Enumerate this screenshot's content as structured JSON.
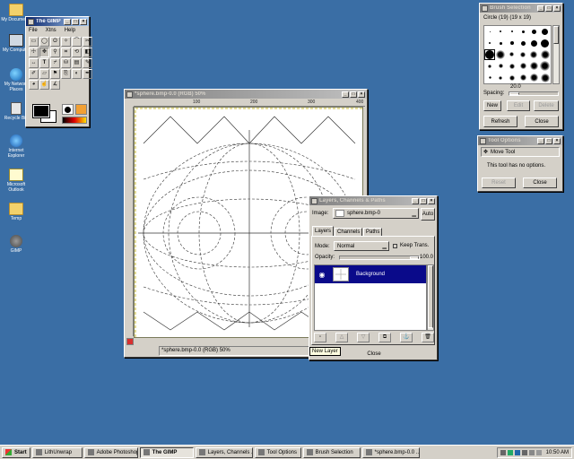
{
  "desktop": {
    "icons": [
      {
        "label": "My Documents",
        "icon": "folder-icon"
      },
      {
        "label": "My Computer",
        "icon": "computer-icon"
      },
      {
        "label": "My Network Places",
        "icon": "network-icon"
      },
      {
        "label": "Recycle Bin",
        "icon": "recycle-bin-icon"
      },
      {
        "label": "Internet Explorer",
        "icon": "internet-explorer-icon"
      },
      {
        "label": "Microsoft Outlook",
        "icon": "outlook-icon"
      },
      {
        "label": "Temp",
        "icon": "folder-icon"
      },
      {
        "label": "GIMP",
        "icon": "gimp-icon"
      }
    ]
  },
  "toolbox": {
    "title": "The GIMP",
    "menu": [
      "File",
      "Xtns",
      "Help"
    ]
  },
  "brush": {
    "title": "Brush Selection",
    "brush_name": "Circle (19)  (19 x 19)",
    "spacing_label": "Spacing:",
    "spacing_value": "20.0",
    "buttons": {
      "new": "New",
      "edit": "Edit",
      "delete": "Delete",
      "refresh": "Refresh",
      "close": "Close"
    }
  },
  "tool_options": {
    "title": "Tool Options",
    "tool_name": "Move Tool",
    "message": "This tool has no options.",
    "reset": "Reset",
    "close": "Close"
  },
  "image_window": {
    "title": "*sphere.bmp-0.0 (RGB) 50%",
    "status": "*sphere.bmp-0.0 (RGB) 50%",
    "ruler_marks": [
      "100",
      "200",
      "300",
      "400"
    ]
  },
  "layers": {
    "title": "Layers, Channels & Paths",
    "image_label": "Image:",
    "image_value": "sphere.bmp-0",
    "auto_label": "Auto",
    "tabs": [
      "Layers",
      "Channels",
      "Paths"
    ],
    "mode_label": "Mode:",
    "mode_value": "Normal",
    "keep_trans_label": "Keep Trans.",
    "opacity_label": "Opacity:",
    "opacity_value": "100.0",
    "layer_name": "Background",
    "tooltip": "New Layer",
    "close": "Close"
  },
  "taskbar": {
    "start": "Start",
    "items": [
      "LithUnwrap",
      "Adobe Photoshop",
      "The GIMP",
      "Layers, Channels ...",
      "Tool Options",
      "Brush Selection",
      "*sphere.bmp-0.0 ..."
    ],
    "active_index": 2,
    "clock": "10:50 AM"
  },
  "colors": {
    "desktop": "#3a6ea5",
    "title_active": "#0a246a",
    "selection": "#0a0a8a"
  }
}
